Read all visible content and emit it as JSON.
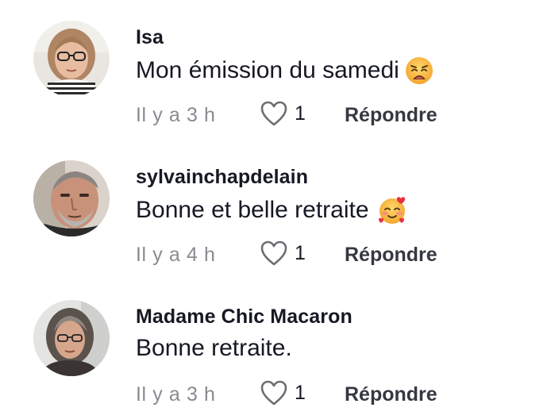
{
  "comments": [
    {
      "username": "Isa",
      "text": "Mon émission du samedi",
      "emoji": "weary-face",
      "time": "Il y a 3 h",
      "likes": "1",
      "reply_label": "Répondre"
    },
    {
      "username": "sylvainchapdelain",
      "text": "Bonne et belle retraite",
      "emoji": "smiling-face-with-hearts",
      "time": "Il y a 4 h",
      "likes": "1",
      "reply_label": "Répondre"
    },
    {
      "username": "Madame Chic Macaron",
      "text": "Bonne retraite.",
      "emoji": "",
      "time": "Il y a 3 h",
      "likes": "1",
      "reply_label": "Répondre"
    }
  ],
  "colors": {
    "text_primary": "#161823",
    "text_secondary": "#8a8b91",
    "reply": "#363841"
  }
}
